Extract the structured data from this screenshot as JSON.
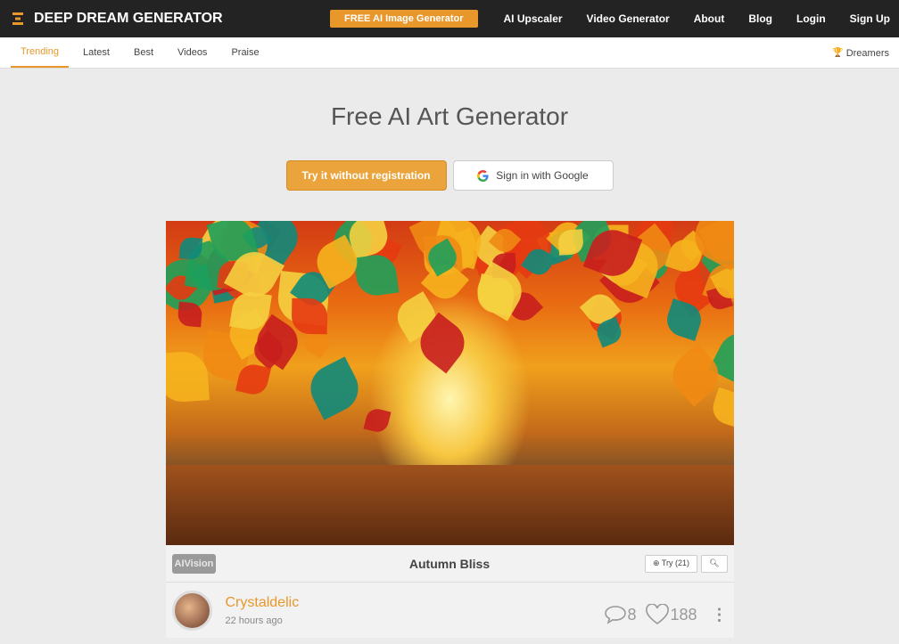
{
  "header": {
    "logo": "DEEP DREAM GENERATOR",
    "nav": [
      {
        "label": "FREE AI Image Generator"
      },
      {
        "label": "AI Upscaler"
      },
      {
        "label": "Video Generator"
      },
      {
        "label": "About"
      },
      {
        "label": "Blog"
      },
      {
        "label": "Login"
      },
      {
        "label": "Sign Up"
      }
    ],
    "accent": "#e8972b"
  },
  "tabs": [
    {
      "label": "Trending",
      "active": true
    },
    {
      "label": "Latest"
    },
    {
      "label": "Best"
    },
    {
      "label": "Videos"
    },
    {
      "label": "Praise"
    }
  ],
  "dreamers": {
    "label": "Dreamers",
    "icon": "trophy-icon"
  },
  "hero": {
    "title": "Free AI Art Generator",
    "try_button": "Try it without registration",
    "google_button": "Sign in with Google"
  },
  "post": {
    "badge": "AIVision",
    "title": "Autumn Bliss",
    "try_label": "Try (21)",
    "author": "Crystaldelic",
    "time": "22 hours ago",
    "comments": "8",
    "likes": "188"
  }
}
